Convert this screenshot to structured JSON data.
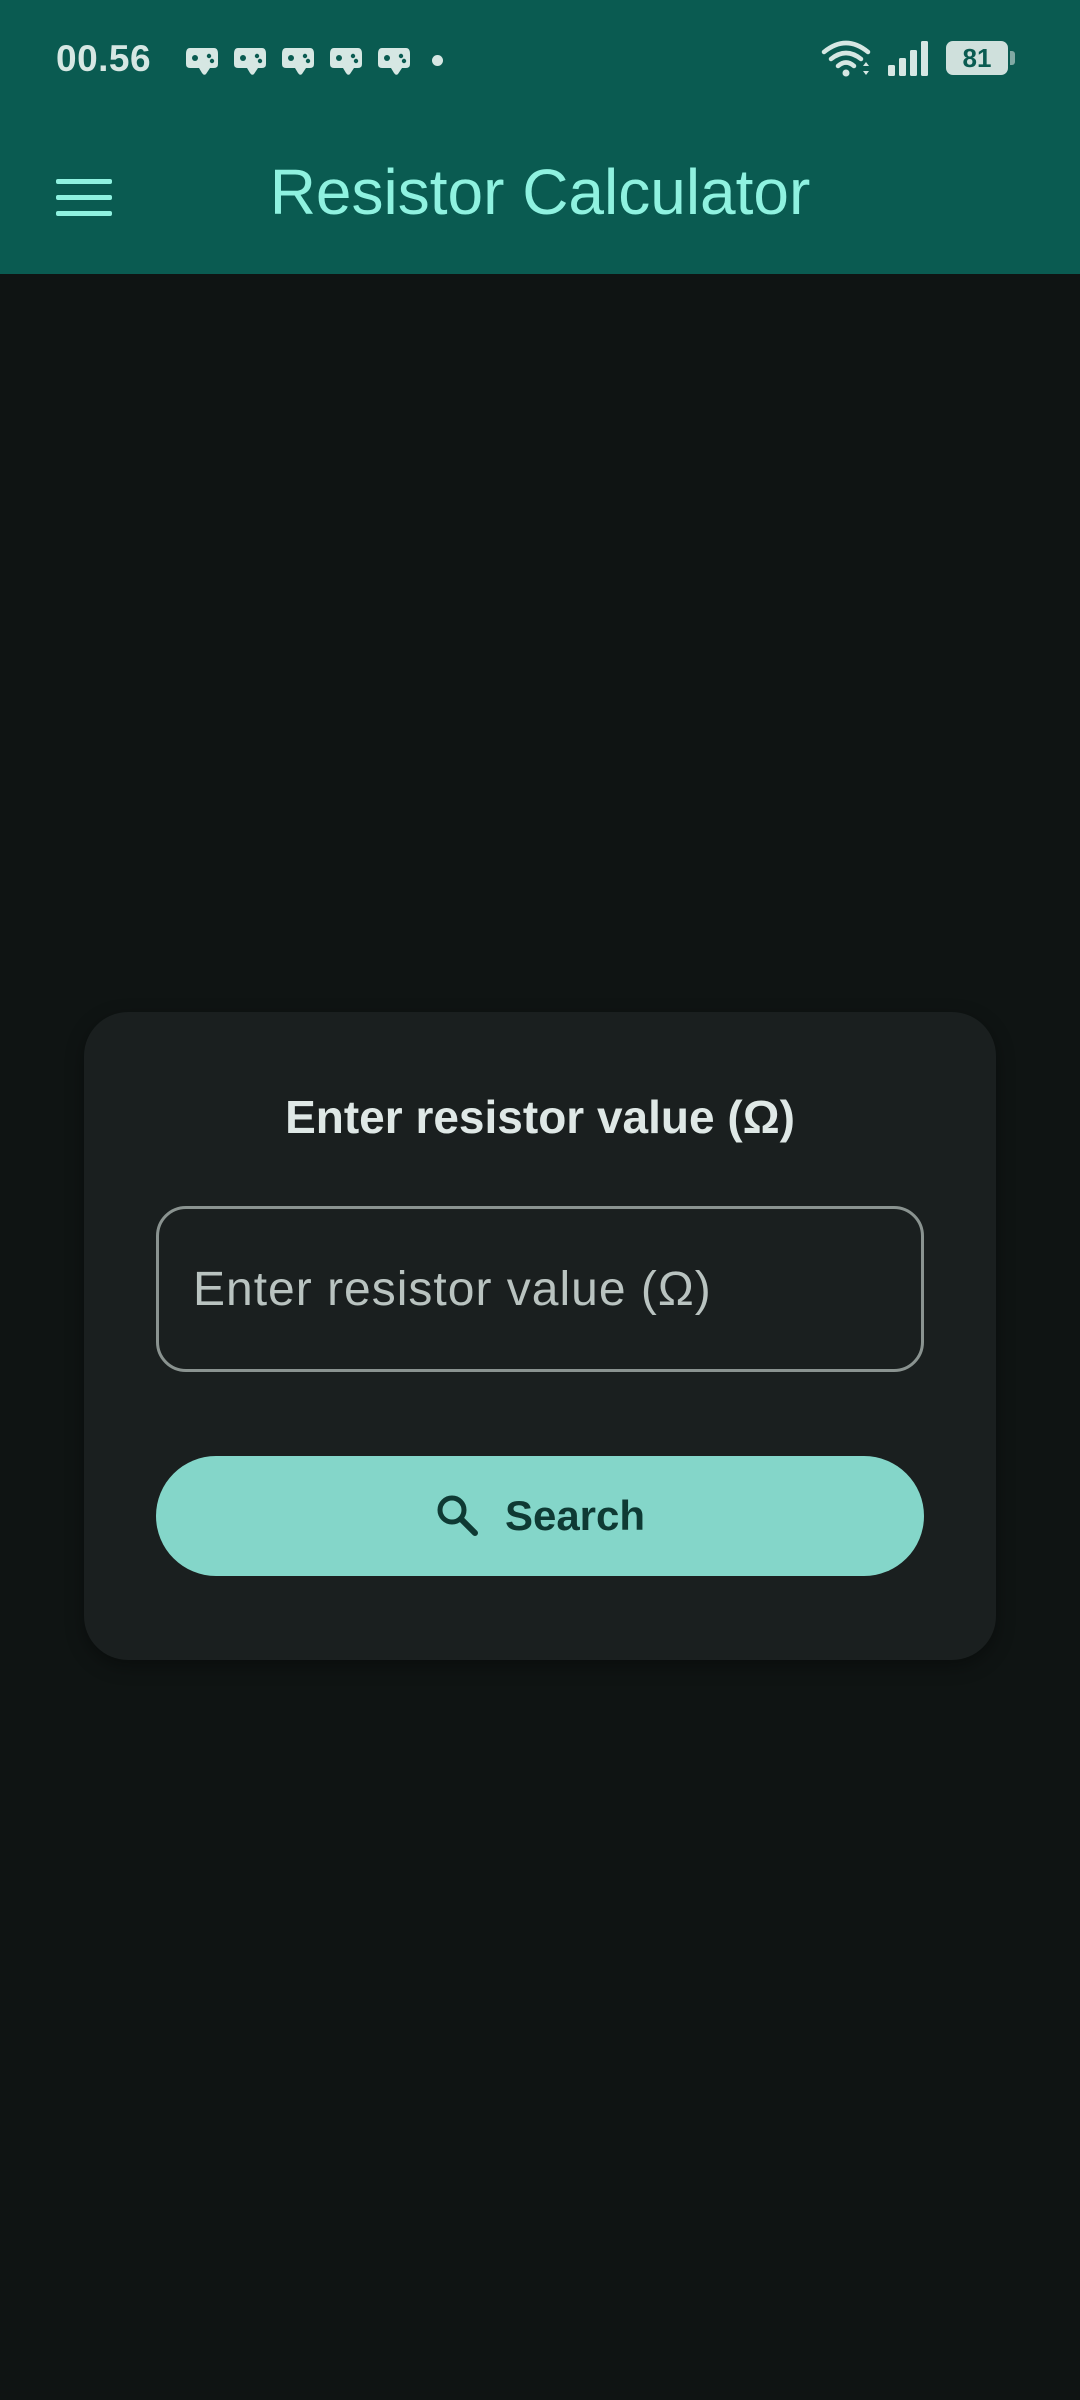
{
  "status_bar": {
    "time": "00.56",
    "notification_icons": [
      "game-controller-icon",
      "game-controller-icon",
      "game-controller-icon",
      "game-controller-icon",
      "game-controller-icon"
    ],
    "battery_level": "81",
    "wifi_icon": "wifi-icon",
    "signal_icon": "signal-icon"
  },
  "app_bar": {
    "title": "Resistor Calculator",
    "menu_icon": "menu-icon"
  },
  "card": {
    "heading": "Enter resistor value (Ω)",
    "input": {
      "placeholder": "Enter resistor value (Ω)",
      "value": ""
    },
    "search_button": {
      "label": "Search",
      "icon": "search-icon"
    }
  },
  "colors": {
    "app_bar_background": "#0a5b51",
    "title_color": "#8ff2e0",
    "page_background": "#0f1413",
    "card_background": "#1a1f1f",
    "button_background": "#84d6c9",
    "button_text": "#0f3a34"
  }
}
